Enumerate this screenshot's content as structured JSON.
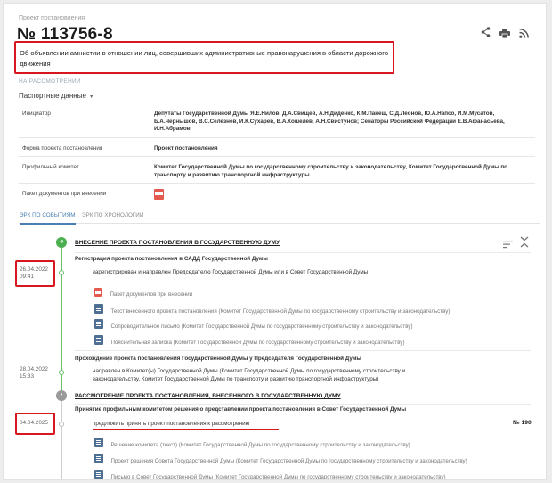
{
  "header": {
    "kind_label": "Проект постановления",
    "number": "№ 113756-8",
    "description": "Об объявлении амнистии в отношении лиц, совершивших административные правонарушения в области дорожного движения",
    "status": "НА РАССМОТРЕНИИ"
  },
  "actions": {
    "share_icon": "share-icon",
    "print_icon": "print-icon",
    "rss_icon": "rss-icon"
  },
  "passport": {
    "heading": "Паспортные данные",
    "rows": [
      {
        "key": "Инициатор",
        "value": "Депутаты Государственной Думы Я.Е.Нилов, Д.А.Свищев, А.Н.Диденко, К.М.Панеш, С.Д.Леонов, Ю.А.Напсо, И.М.Мусатов, Б.А.Чернышов, В.С.Селезнев, И.К.Сухарев, В.А.Кошелев, А.Н.Свистунов; Сенаторы Российской Федерации Е.В.Афанасьева, И.Н.Абрамов"
      },
      {
        "key": "Форма проекта постановления",
        "value": "Проект постановления"
      },
      {
        "key": "Профильный комитет",
        "value": "Комитет Государственной Думы по государственному строительству и законодательству, Комитет Государственной Думы по транспорту и развитию транспортной инфраструктуры"
      },
      {
        "key": "Пакет документов при внесении",
        "value": ""
      }
    ]
  },
  "tabs": [
    {
      "label": "ЭРК ПО СОБЫТИЯМ",
      "active": true
    },
    {
      "label": "ЭРК ПО ХРОНОЛОГИИ",
      "active": false
    }
  ],
  "timeline": {
    "stage1": {
      "title": "ВНЕСЕНИЕ ПРОЕКТА ПОСТАНОВЛЕНИЯ В ГОСУДАРСТВЕННУЮ ДУМУ",
      "sub1": "Регистрация проекта постановления в САДД Государственной Думы",
      "date1": "26.04.2022",
      "time1": "09:41",
      "event1": "зарегистрирован и направлен Председателю Государственной Думы или в Совет Государственной Думы",
      "docs1": [
        {
          "icon": "pdf-icon",
          "label": "Пакет документов при внесении"
        },
        {
          "icon": "doc-icon",
          "label": "Текст внесенного проекта постановления (Комитет Государственной Думы по государственному строительству и законодательству)"
        },
        {
          "icon": "doc-icon",
          "label": "Сопроводительное письмо (Комитет Государственной Думы по государственному строительству и законодательству)"
        },
        {
          "icon": "doc-icon",
          "label": "Пояснительная записка (Комитет Государственной Думы по государственному строительству и законодательству)"
        }
      ],
      "sub2": "Прохождение проекта постановления Государственной Думы у Председателя Государственной Думы",
      "date2": "28.04.2022",
      "time2": "15:33",
      "event2": "направлен в Комитет(ы) Государственной Думы (Комитет Государственной Думы по государственному строительству и законодательству, Комитет Государственной Думы по транспорту и развитию транспортной инфраструктуры)"
    },
    "stage2": {
      "title": "РАССМОТРЕНИЕ ПРОЕКТА ПОСТАНОВЛЕНИЯ, ВНЕСЕННОГО В ГОСУДАРСТВЕННУЮ ДУМУ",
      "sub1": "Принятие профильным комитетом решения о представлении проекта постановления в Совет Государственной Думы",
      "date1": "04.04.2025",
      "event1": "предложить принять проект постановления к рассмотрению",
      "number": "№ 190",
      "docs1": [
        {
          "icon": "doc-icon",
          "label": "Решение комитета (текст) (Комитет Государственной Думы по государственному строительству и законодательству)"
        },
        {
          "icon": "doc-icon",
          "label": "Проект решения Совета Государственной Думы (Комитет Государственной Думы по государственному строительству и законодательству)"
        },
        {
          "icon": "doc-icon",
          "label": "Письмо в Совет Государственной Думы (Комитет Государственной Думы по государственному строительству и законодательству)"
        }
      ]
    }
  },
  "colors": {
    "highlight": "#d7161e",
    "timeline_green": "#4caf50",
    "tab_active": "#4a7fb3"
  }
}
